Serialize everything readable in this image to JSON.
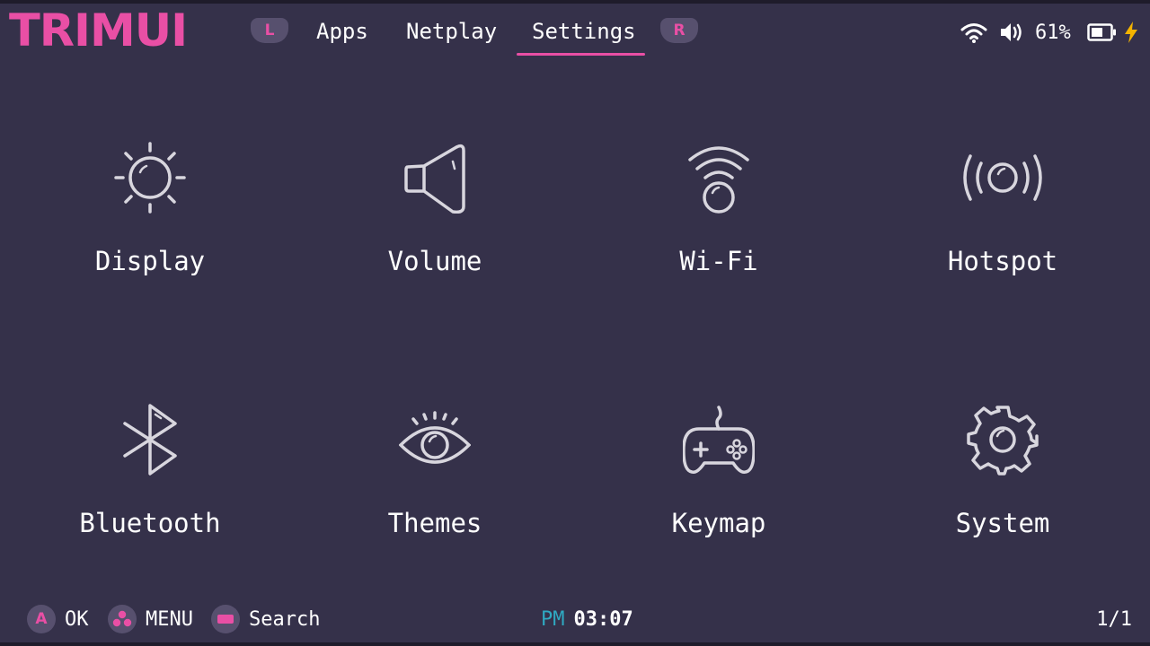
{
  "header": {
    "logo": "TRIMUI",
    "left_shoulder": "L",
    "right_shoulder": "R",
    "tabs": [
      {
        "label": "Apps",
        "active": false
      },
      {
        "label": "Netplay",
        "active": false
      },
      {
        "label": "Settings",
        "active": true
      }
    ],
    "status": {
      "volume_percent": "61%",
      "icons": [
        "wifi-icon",
        "speaker-icon",
        "battery-icon",
        "charging-bolt-icon"
      ]
    }
  },
  "grid": {
    "items": [
      {
        "label": "Display",
        "icon": "sun-icon"
      },
      {
        "label": "Volume",
        "icon": "speaker-icon"
      },
      {
        "label": "Wi-Fi",
        "icon": "wifi-icon"
      },
      {
        "label": "Hotspot",
        "icon": "hotspot-icon"
      },
      {
        "label": "Bluetooth",
        "icon": "bluetooth-icon"
      },
      {
        "label": "Themes",
        "icon": "eye-icon"
      },
      {
        "label": "Keymap",
        "icon": "gamepad-icon"
      },
      {
        "label": "System",
        "icon": "gear-icon"
      }
    ]
  },
  "footer": {
    "hints": [
      {
        "button": "A",
        "label": "OK"
      },
      {
        "button": "three-dots",
        "label": "MENU"
      },
      {
        "button": "select-bar",
        "label": "Search"
      }
    ],
    "clock": {
      "ampm": "PM",
      "time": "03:07"
    },
    "page": "1/1"
  },
  "colors": {
    "background": "#35314a",
    "accent": "#e94fa5",
    "icon": "#d8d6de",
    "button_bg": "#57506e",
    "ampm": "#2fa9c2"
  }
}
